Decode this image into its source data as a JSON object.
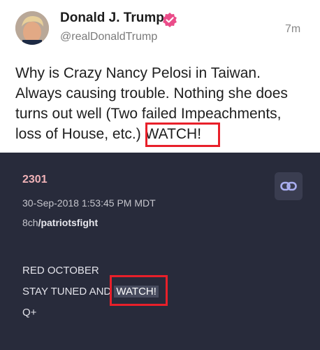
{
  "post": {
    "display_name": "Donald J. Trump",
    "handle": "@realDonaldTrump",
    "timestamp": "7m",
    "text_before": "Why is Crazy Nancy Pelosi in Taiwan. Always causing trouble. Nothing she does turns out well (Two failed Impeachments, loss of House, etc.) ",
    "text_highlight": "WATCH!",
    "colors": {
      "verified_badge": "#ea4c89",
      "highlight_box": "#e8202a"
    }
  },
  "qpost": {
    "number": "2301",
    "date": "30-Sep-2018 1:53:45 PM MDT",
    "board_prefix": "8ch",
    "board_name": "/patriotsfight",
    "line1": "RED OCTOBER",
    "line2_before": "STAY TUNED AND ",
    "line2_highlight": "WATCH!",
    "line3": "Q+",
    "link_icon": "chain-link-icon",
    "colors": {
      "background": "#282b3b",
      "number": "#f0b2b7"
    }
  }
}
